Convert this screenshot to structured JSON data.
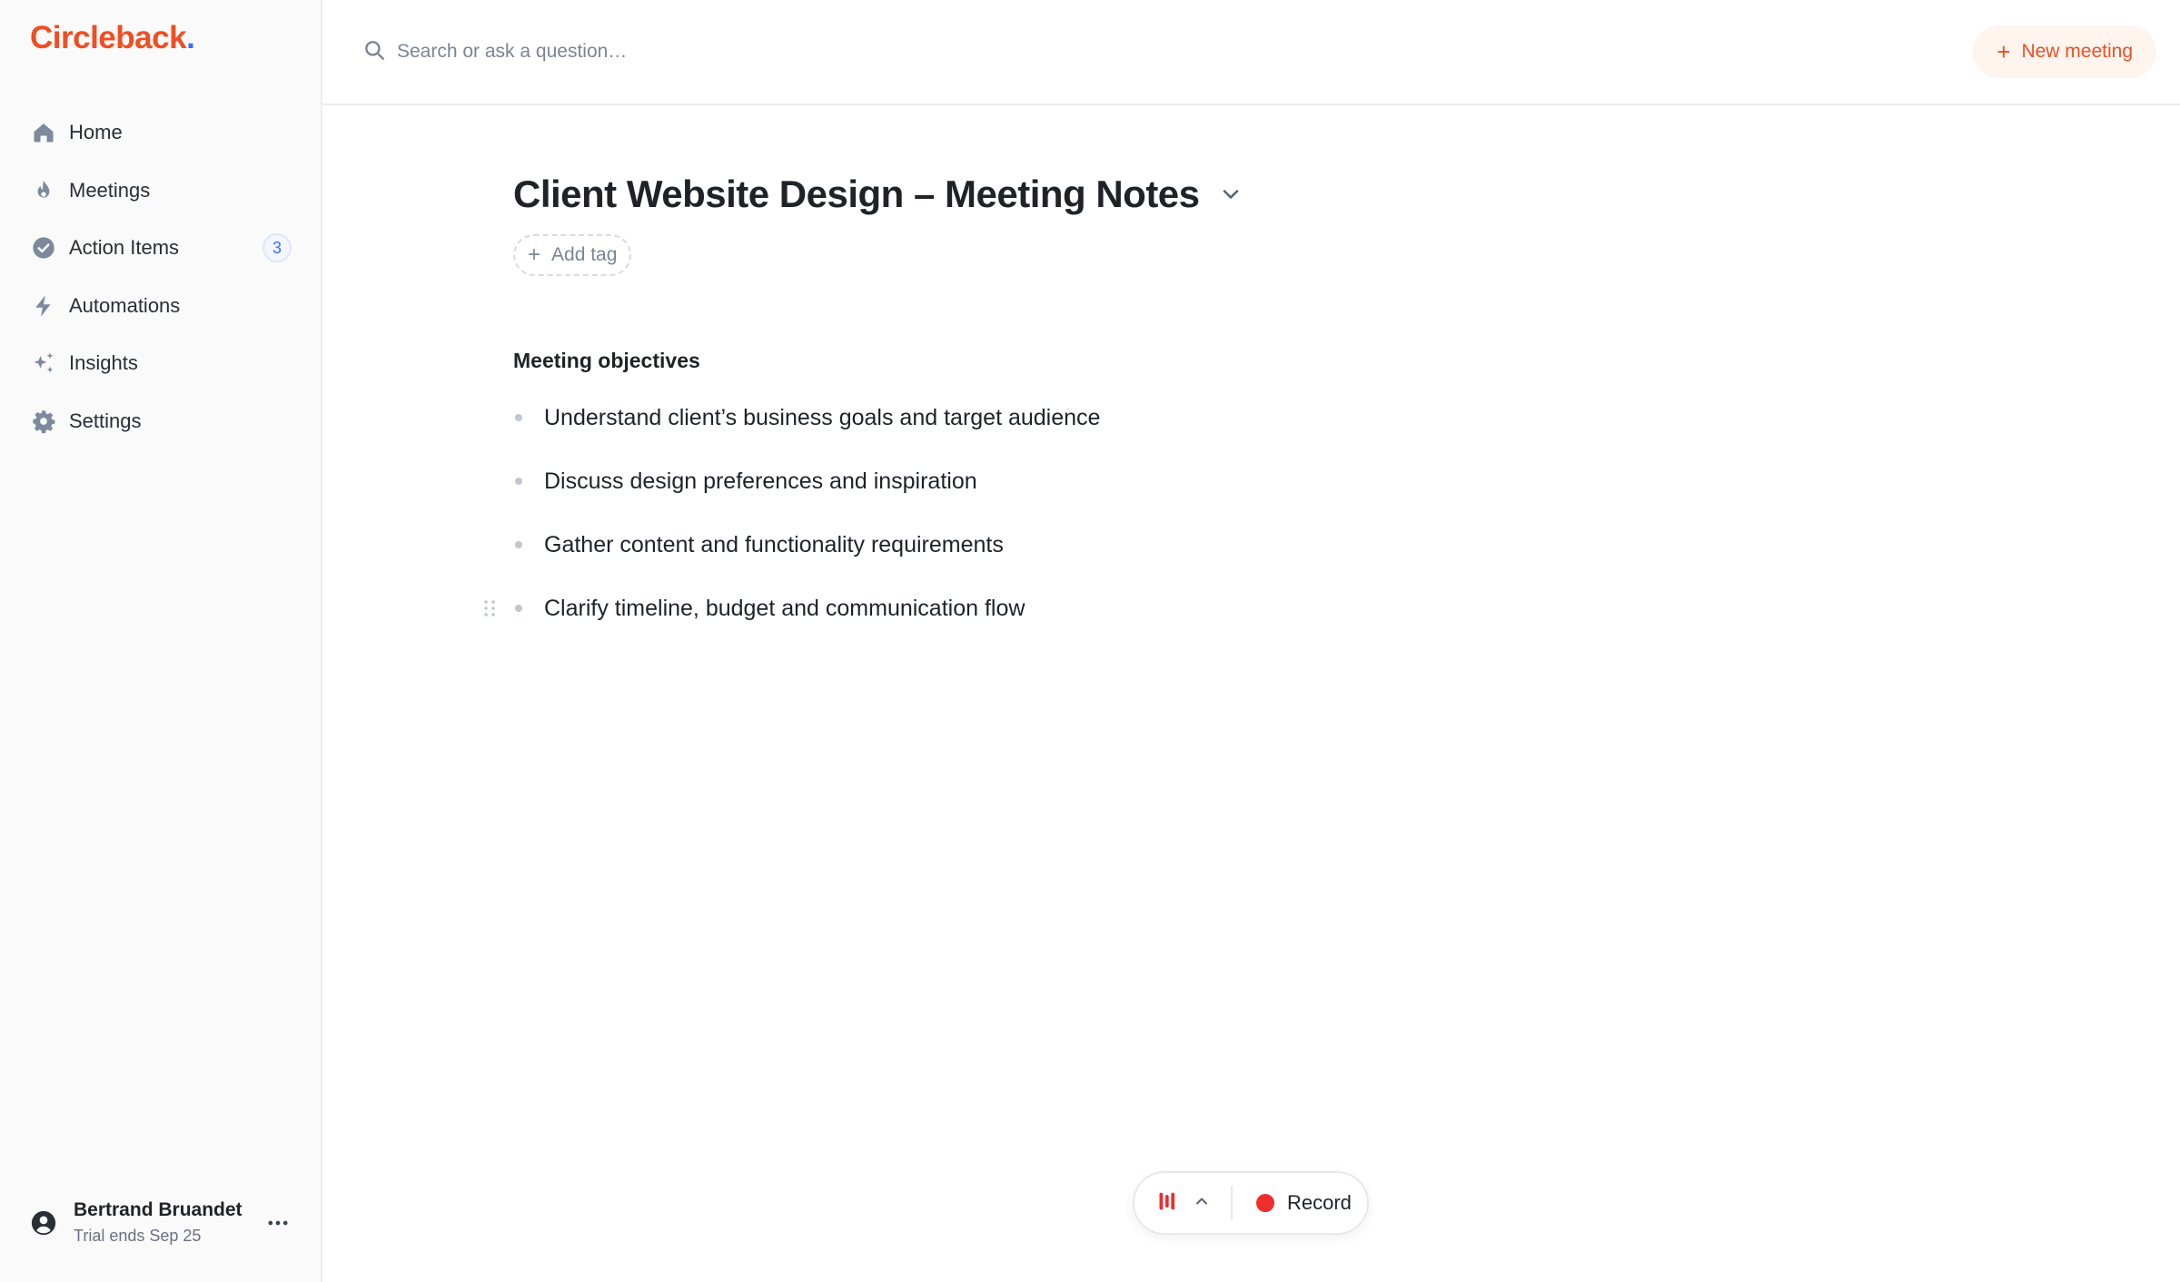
{
  "brand": {
    "name": "Circleback",
    "dot": ".",
    "accent": "#f04e23",
    "dot_color": "#3b6ef6"
  },
  "sidebar": {
    "items": [
      {
        "label": "Home",
        "icon": "home-icon"
      },
      {
        "label": "Meetings",
        "icon": "flame-icon"
      },
      {
        "label": "Action Items",
        "icon": "check-circle-icon",
        "badge": "3"
      },
      {
        "label": "Automations",
        "icon": "bolt-icon"
      },
      {
        "label": "Insights",
        "icon": "sparkles-icon"
      },
      {
        "label": "Settings",
        "icon": "gear-icon"
      }
    ],
    "user": {
      "name": "Bertrand Bruandet",
      "trial": "Trial ends Sep 25"
    }
  },
  "topbar": {
    "search_placeholder": "Search or ask a question…",
    "new_meeting_label": "New meeting"
  },
  "document": {
    "title": "Client Website Design – Meeting Notes",
    "add_tag_label": "Add tag",
    "section_title": "Meeting objectives",
    "bullets": [
      "Understand client’s business goals and target audience",
      "Discuss design preferences and inspiration",
      "Gather content and functionality requirements",
      "Clarify timeline, budget and communication flow"
    ]
  },
  "recorder": {
    "record_label": "Record",
    "record_color": "#ef2d2d"
  }
}
